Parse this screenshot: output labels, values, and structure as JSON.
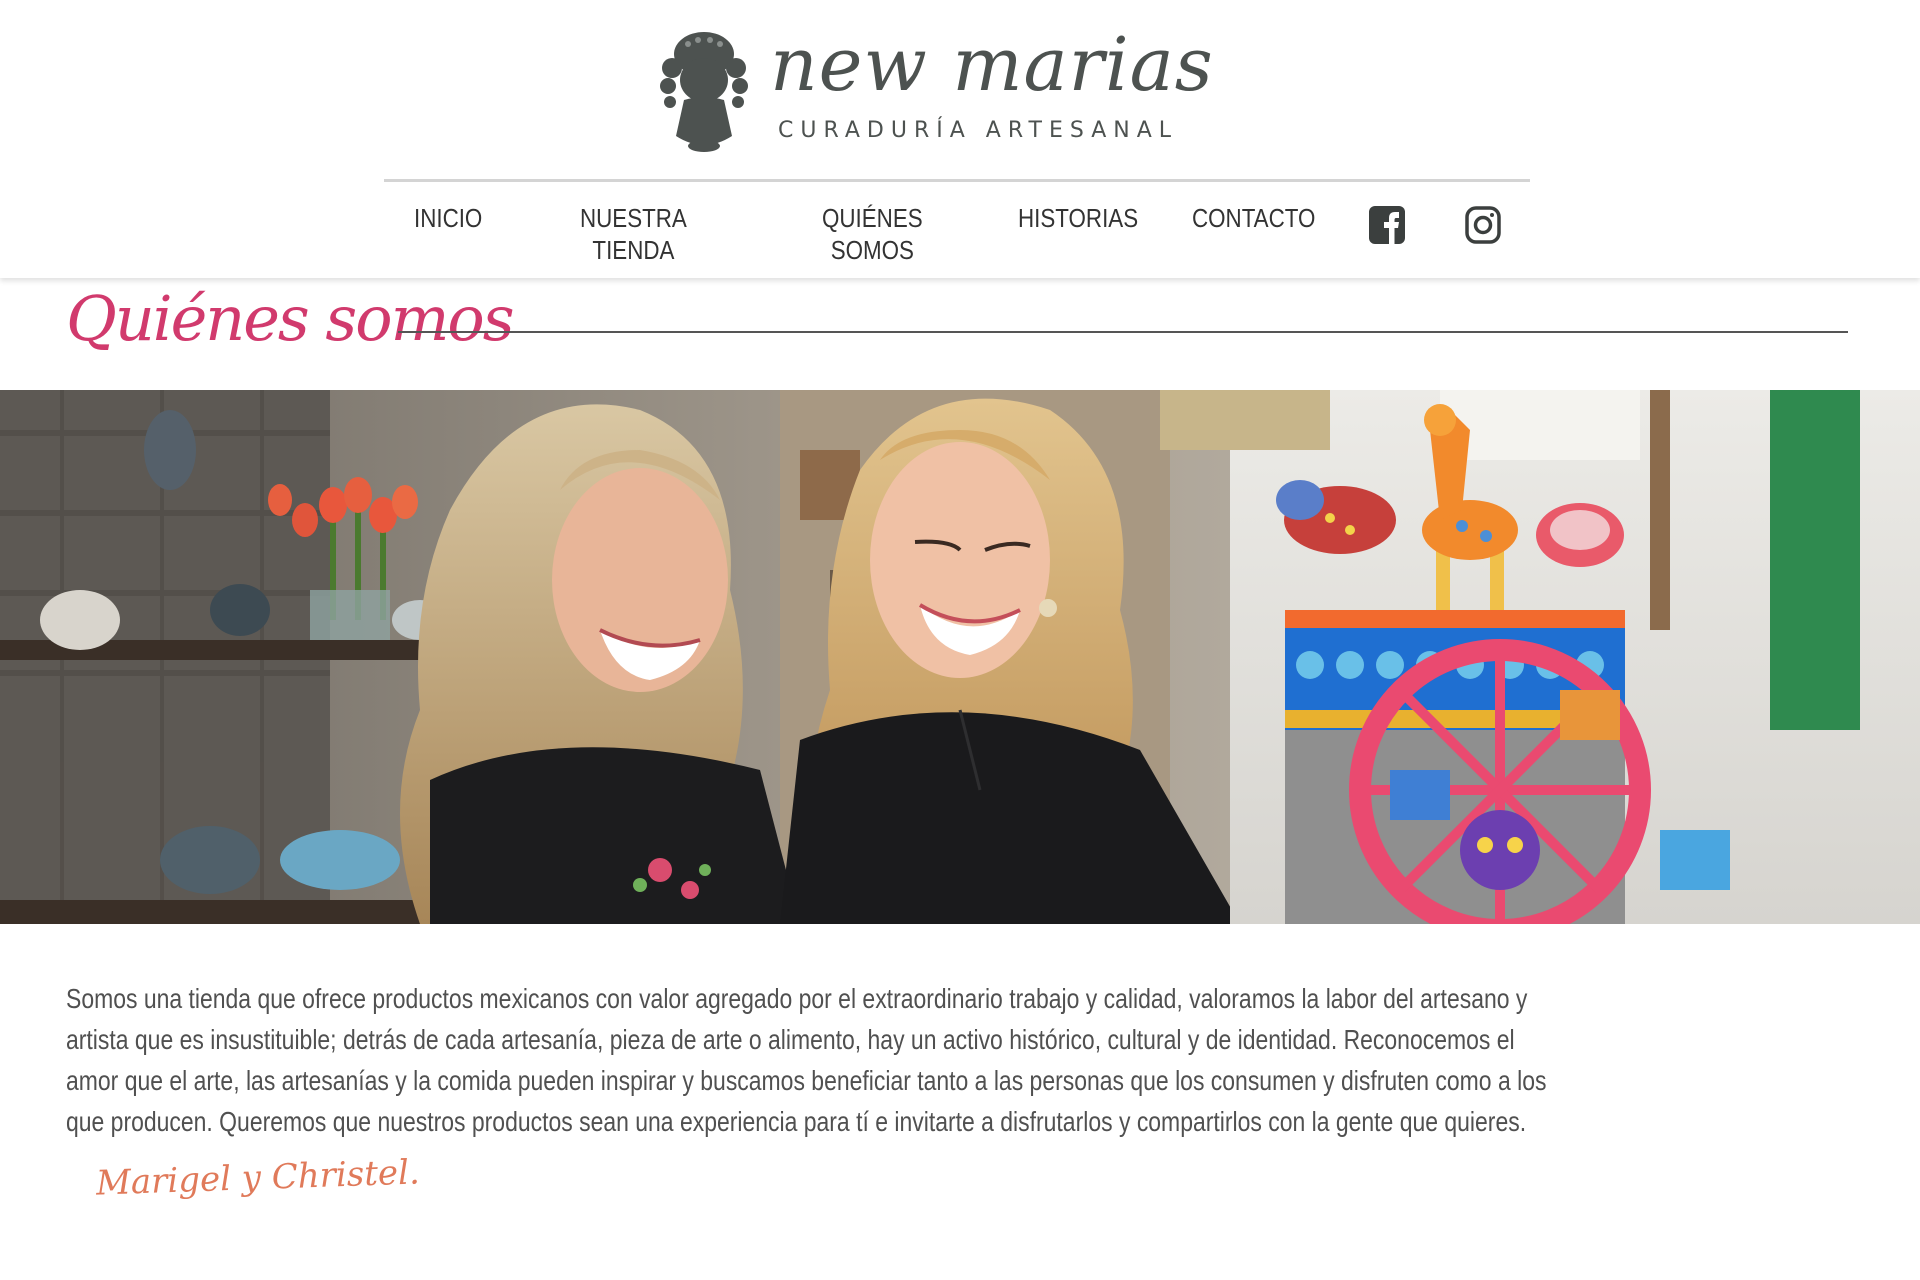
{
  "brand": {
    "name": "new marias",
    "tagline": "CURADURÍA ARTESANAL"
  },
  "nav": {
    "items": [
      {
        "label": "INICIO"
      },
      {
        "label": "NUESTRA\nTIENDA"
      },
      {
        "label": "QUIÉNES\nSOMOS"
      },
      {
        "label": "HISTORIAS"
      },
      {
        "label": "CONTACTO"
      }
    ],
    "social": [
      "facebook-icon",
      "instagram-icon"
    ]
  },
  "page": {
    "title": "Quiénes somos",
    "body": "Somos una tienda que ofrece productos mexicanos con valor agregado por el extraordinario trabajo y calidad, valoramos la labor del artesano y artista que es insustituible; detrás de cada artesanía, pieza de arte o alimento, hay un activo histórico, cultural y de identidad. Reconocemos el amor que el arte, las artesanías y la comida pueden inspirar y buscamos beneficiar tanto a las personas que los consumen y disfruten como a los que producen. Queremos que nuestros productos sean una experiencia para tí e invitarte a disfrutarlos y compartirlos con la gente que quieres.",
    "signature": "Marigel y Christel."
  },
  "colors": {
    "accent_pink": "#d13a6d",
    "signature_orange": "#e07a5a",
    "text_gray": "#505050",
    "logo_gray": "#4d5250"
  }
}
